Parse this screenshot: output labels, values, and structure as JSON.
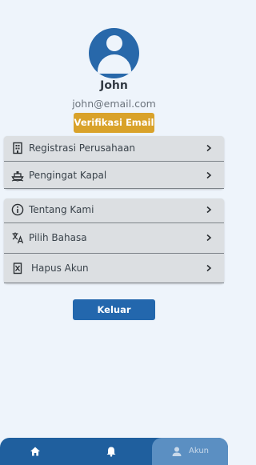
{
  "profile": {
    "name": "John",
    "email": "john@email.com",
    "verify_label": "Verifikasi Email"
  },
  "menu_group_1": [
    {
      "label": "Registrasi Perusahaan",
      "icon": "building-icon"
    },
    {
      "label": "Pengingat Kapal",
      "icon": "ship-icon"
    }
  ],
  "menu_group_2": [
    {
      "label": "Tentang Kami",
      "icon": "info-icon"
    },
    {
      "label": "Pilih Bahasa",
      "icon": "translate-icon"
    },
    {
      "label": "Hapus Akun",
      "icon": "delete-account-icon"
    }
  ],
  "logout_label": "Keluar",
  "bottom_nav": {
    "items": [
      {
        "icon": "home-icon"
      },
      {
        "icon": "bell-icon"
      },
      {
        "icon": "person-icon",
        "label": "Akun",
        "active": true
      }
    ]
  },
  "colors": {
    "primary": "#2367ad",
    "accent": "#d9a22a",
    "background": "#eef4fb"
  }
}
